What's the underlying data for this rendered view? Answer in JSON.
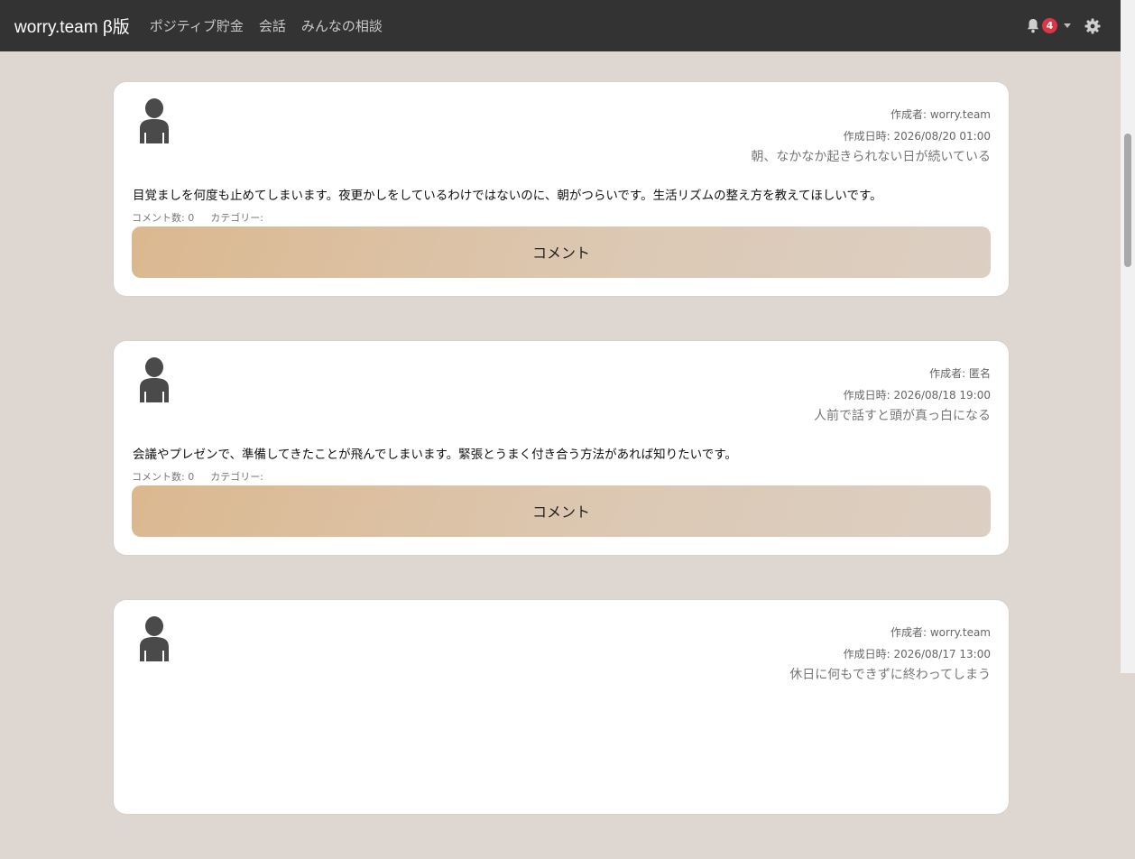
{
  "navbar": {
    "brand": "worry.team β版",
    "links": [
      {
        "label": "ポジティブ貯金"
      },
      {
        "label": "会話"
      },
      {
        "label": "みんなの相談"
      }
    ],
    "notification_count": "4",
    "bell_icon": "bell-icon",
    "settings_icon": "gear-icon"
  },
  "colors": {
    "navbar_bg": "#333333",
    "page_bg": "#ddd6d1",
    "badge": "#dc3545",
    "button_from": "#dbb88f",
    "button_to": "#dccfc3"
  },
  "posts": [
    {
      "author_label": "作成者: ",
      "author": "worry.team",
      "date_label": "作成日時: ",
      "date": "2026/08/20 01:00",
      "title": "朝、なかなか起きられない日が続いている",
      "body": "目覚ましを何度も止めてしまいます。夜更かしをしているわけではないのに、朝がつらいです。生活リズムの整え方を教えてほしいです。",
      "comment_count_label": "コメント数: 0",
      "category_label": "カテゴリー:",
      "button_label": "コメント"
    },
    {
      "author_label": "作成者: ",
      "author": "匿名",
      "date_label": "作成日時: ",
      "date": "2026/08/18 19:00",
      "title": "人前で話すと頭が真っ白になる",
      "body": "会議やプレゼンで、準備してきたことが飛んでしまいます。緊張とうまく付き合う方法があれば知りたいです。",
      "comment_count_label": "コメント数: 0",
      "category_label": "カテゴリー:",
      "button_label": "コメント"
    },
    {
      "author_label": "作成者: ",
      "author": "worry.team",
      "date_label": "作成日時: ",
      "date": "2026/08/17 13:00",
      "title": "休日に何もできずに終わってしまう"
    }
  ]
}
